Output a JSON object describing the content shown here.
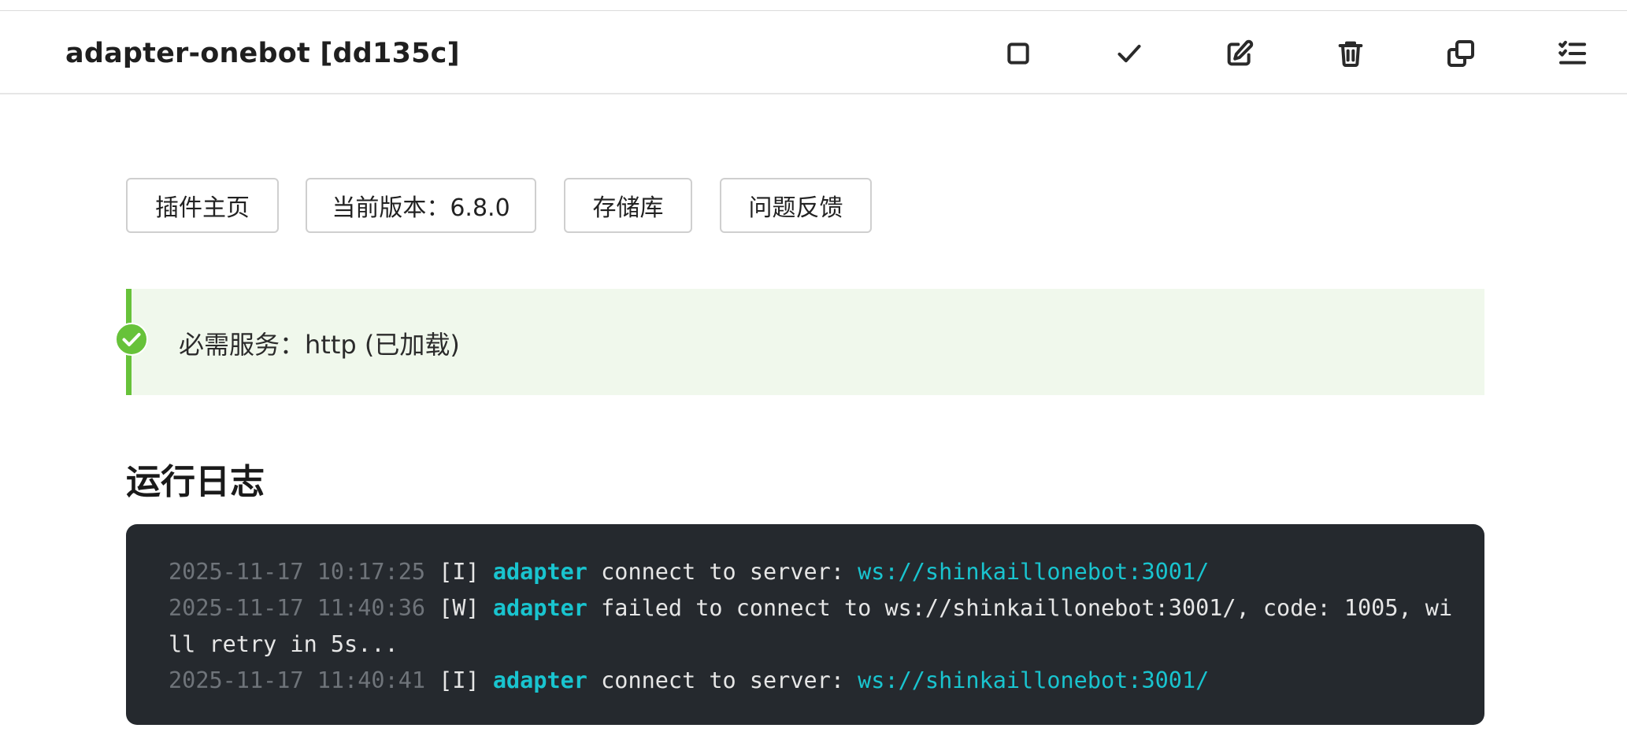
{
  "header": {
    "title": "adapter-onebot [dd135c]",
    "toolbar": [
      {
        "name": "square-icon"
      },
      {
        "name": "check-icon"
      },
      {
        "name": "edit-icon"
      },
      {
        "name": "trash-icon"
      },
      {
        "name": "copy-icon"
      },
      {
        "name": "checklist-icon"
      }
    ]
  },
  "links": {
    "homepage": "插件主页",
    "version": "当前版本：6.8.0",
    "repository": "存储库",
    "feedback": "问题反馈"
  },
  "service": {
    "text": "必需服务：http (已加载)",
    "color": "#67c23a",
    "icon": "check-circle-icon"
  },
  "logs": {
    "title": "运行日志",
    "lines": [
      {
        "timestamp": "2025-11-17 10:17:25",
        "level": "[I]",
        "source": "adapter",
        "message": "connect to server: ",
        "url": "ws://shinkaillonebot:3001/"
      },
      {
        "timestamp": "2025-11-17 11:40:36",
        "level": "[W]",
        "source": "adapter",
        "message": "failed to connect to ws://shinkaillonebot:3001/, code: 1005, wi",
        "continuation": "ll retry in 5s..."
      },
      {
        "timestamp": "2025-11-17 11:40:41",
        "level": "[I]",
        "source": "adapter",
        "message": "connect to server: ",
        "url": "ws://shinkaillonebot:3001/"
      }
    ]
  }
}
